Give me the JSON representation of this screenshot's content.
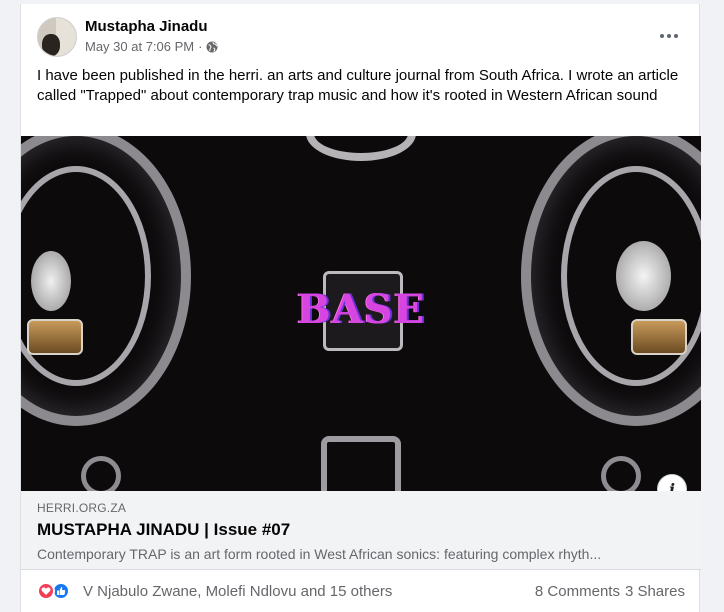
{
  "post": {
    "author": "Mustapha Jinadu",
    "timestamp": "May 30 at 7:06 PM",
    "separator": "·",
    "privacy_icon": "globe-icon",
    "text": "I have been published in the herri. an arts and culture journal from South Africa. I wrote an article called \"Trapped\" about contemporary trap music and how it's rooted in Western African sound"
  },
  "link": {
    "image_text": "BASE",
    "domain": "HERRI.ORG.ZA",
    "title": "MUSTAPHA JINADU | Issue #07",
    "description": "Contemporary TRAP is an art form rooted in West African sonics: featuring complex rhyth..."
  },
  "reactions": {
    "icons": [
      "love-icon",
      "like-icon"
    ],
    "reactors": "V Njabulo Zwane, Molefi Ndlovu and 15 others",
    "comments": "8 Comments",
    "shares": "3 Shares"
  },
  "colors": {
    "accent": "#1877f2",
    "love": "#f33e58",
    "base_text": "#d645e0"
  }
}
